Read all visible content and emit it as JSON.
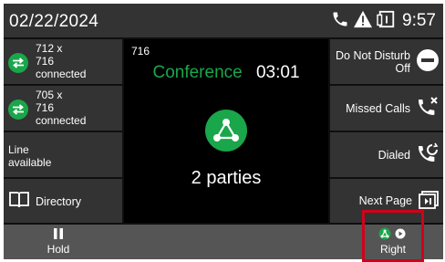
{
  "status_bar": {
    "date": "02/22/2024",
    "time": "9:57",
    "icons": [
      "phone-icon",
      "warning-icon",
      "voicemail-icon"
    ]
  },
  "lines": [
    {
      "line1": "712 x",
      "line2": "716",
      "state": "connected",
      "icon": "call-transfer-icon"
    },
    {
      "line1": "705 x",
      "line2": "716",
      "state": "connected",
      "icon": "call-transfer-icon"
    },
    {
      "line1": "Line",
      "line2": "available"
    }
  ],
  "directory": {
    "label": "Directory",
    "icon": "book-icon"
  },
  "center": {
    "extension": "716",
    "title": "Conference",
    "timer": "03:01",
    "parties": "2 parties",
    "icon": "conference-icon"
  },
  "right_keys": [
    {
      "line1": "Do Not Disturb",
      "line2": "Off",
      "icon": "do-not-disturb-icon"
    },
    {
      "label": "Missed Calls",
      "icon": "missed-call-icon"
    },
    {
      "label": "Dialed",
      "icon": "dialed-call-icon"
    },
    {
      "label": "Next Page",
      "icon": "next-page-icon"
    }
  ],
  "softkeys": {
    "hold": "Hold",
    "right": "Right"
  },
  "colors": {
    "accent": "#1aa64a",
    "panel": "#333333",
    "softbar": "#555555",
    "highlight": "#d0021b"
  }
}
